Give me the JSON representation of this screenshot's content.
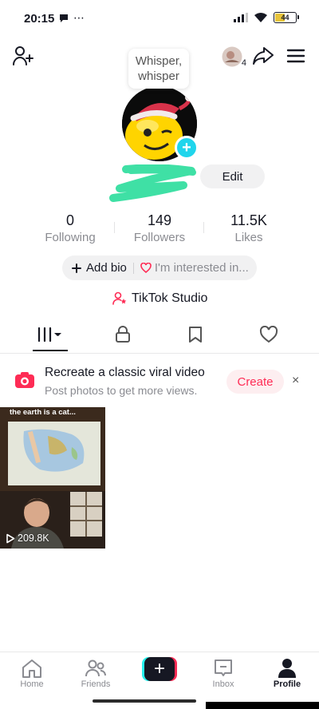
{
  "status_bar": {
    "time": "20:15",
    "extra": "⋯",
    "battery_level": "44",
    "battery_color": "#e8c43a"
  },
  "top_bar": {
    "add_friend_icon": "add-person-icon",
    "notification_count": "4",
    "share_icon": "share-arrow-icon",
    "menu_icon": "hamburger-menu-icon"
  },
  "profile": {
    "whisper_text": "Whisper, whisper",
    "avatar_add_label": "+",
    "edit_label": "Edit"
  },
  "stats": [
    {
      "value": "0",
      "label": "Following"
    },
    {
      "value": "149",
      "label": "Followers"
    },
    {
      "value": "11.5K",
      "label": "Likes"
    }
  ],
  "bio": {
    "add_bio_label": "Add bio",
    "interest_label": "I'm interested in..."
  },
  "studio": {
    "label": "TikTok Studio"
  },
  "tabs": [
    {
      "name": "videos",
      "icon": "grid-icon",
      "active": true
    },
    {
      "name": "private",
      "icon": "lock-icon"
    },
    {
      "name": "favorites",
      "icon": "bookmark-icon"
    },
    {
      "name": "liked",
      "icon": "heart-icon"
    }
  ],
  "promo": {
    "title": "Recreate a classic viral video",
    "subtitle": "Post photos to get more views.",
    "button_label": "Create",
    "close_label": "×"
  },
  "videos": [
    {
      "caption": "the earth is a cat...",
      "views": "209.8K"
    }
  ],
  "bottom_nav": {
    "items": [
      {
        "label": "Home",
        "icon": "home-icon"
      },
      {
        "label": "Friends",
        "icon": "friends-icon"
      },
      {
        "label": "",
        "icon": "create-plus-icon"
      },
      {
        "label": "Inbox",
        "icon": "inbox-icon"
      },
      {
        "label": "Profile",
        "icon": "profile-icon"
      }
    ],
    "create_symbol": "+"
  },
  "colors": {
    "accent": "#fe2c55",
    "cyan": "#25f4ee",
    "text": "#161823",
    "muted": "#8a8b91"
  }
}
